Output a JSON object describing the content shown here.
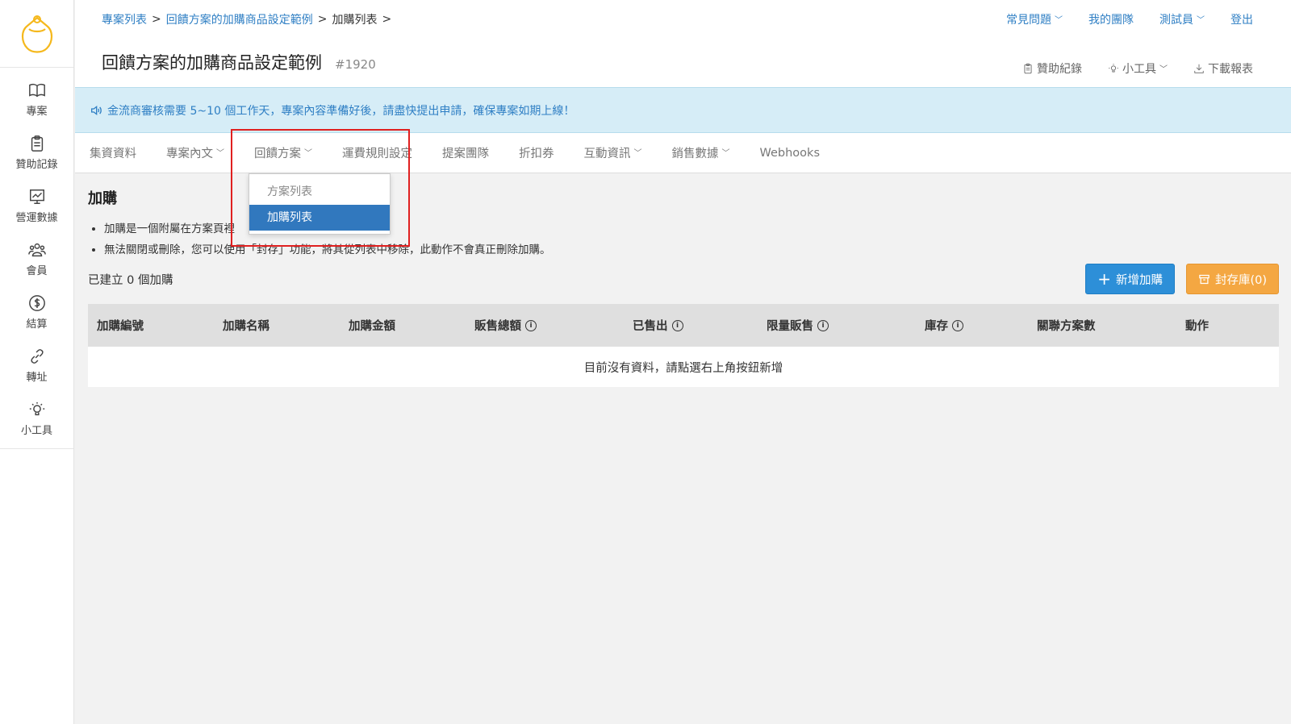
{
  "sidebar": {
    "items": [
      {
        "label": "專案",
        "icon": "book-icon"
      },
      {
        "label": "贊助記錄",
        "icon": "clipboard-icon"
      },
      {
        "label": "營運數據",
        "icon": "chart-icon"
      },
      {
        "label": "會員",
        "icon": "users-icon"
      },
      {
        "label": "結算",
        "icon": "dollar-icon"
      },
      {
        "label": "轉址",
        "icon": "link-icon"
      },
      {
        "label": "小工具",
        "icon": "bulb-icon"
      }
    ]
  },
  "breadcrumb": {
    "item1": "專案列表",
    "item2": "回饋方案的加購商品設定範例",
    "current": "加購列表"
  },
  "header": {
    "title": "回饋方案的加購商品設定範例",
    "project_id": "#1920"
  },
  "topnav": {
    "faq": "常見問題",
    "team": "我的團隊",
    "user": "測試員",
    "logout": "登出"
  },
  "tools": {
    "sponsor_log": "贊助紀錄",
    "widgets": "小工具",
    "download": "下載報表"
  },
  "notice": {
    "text": "金流商審核需要 5~10 個工作天，專案內容準備好後，請盡快提出申請，確保專案如期上線！"
  },
  "tabs": {
    "t1": "集資資料",
    "t2": "專案內文",
    "t3": "回饋方案",
    "t4": "運費規則設定",
    "t5": "提案團隊",
    "t6": "折扣券",
    "t7": "互動資訊",
    "t8": "銷售數據",
    "t9": "Webhooks"
  },
  "dropdown": {
    "item1": "方案列表",
    "item2": "加購列表"
  },
  "main": {
    "heading": "加購",
    "note1": "加購是一個附屬在方案頁裡",
    "note2": "無法關閉或刪除，您可以使用「封存」功能，將其從列表中移除，此動作不會真正刪除加購。",
    "count": "已建立 0 個加購",
    "add_button": "新增加購",
    "archive_button": "封存庫(0)"
  },
  "table": {
    "headers": [
      "加購編號",
      "加購名稱",
      "加購金額",
      "販售總額",
      "已售出",
      "限量販售",
      "庫存",
      "關聯方案數",
      "動作"
    ],
    "empty": "目前沒有資料，請點選右上角按鈕新增"
  },
  "colors": {
    "link": "#2f7fc4",
    "notice_bg": "#d6edf7",
    "primary": "#2d8fd8",
    "warning": "#f4a742",
    "active_menu": "#3178be",
    "highlight": "#e02020"
  }
}
